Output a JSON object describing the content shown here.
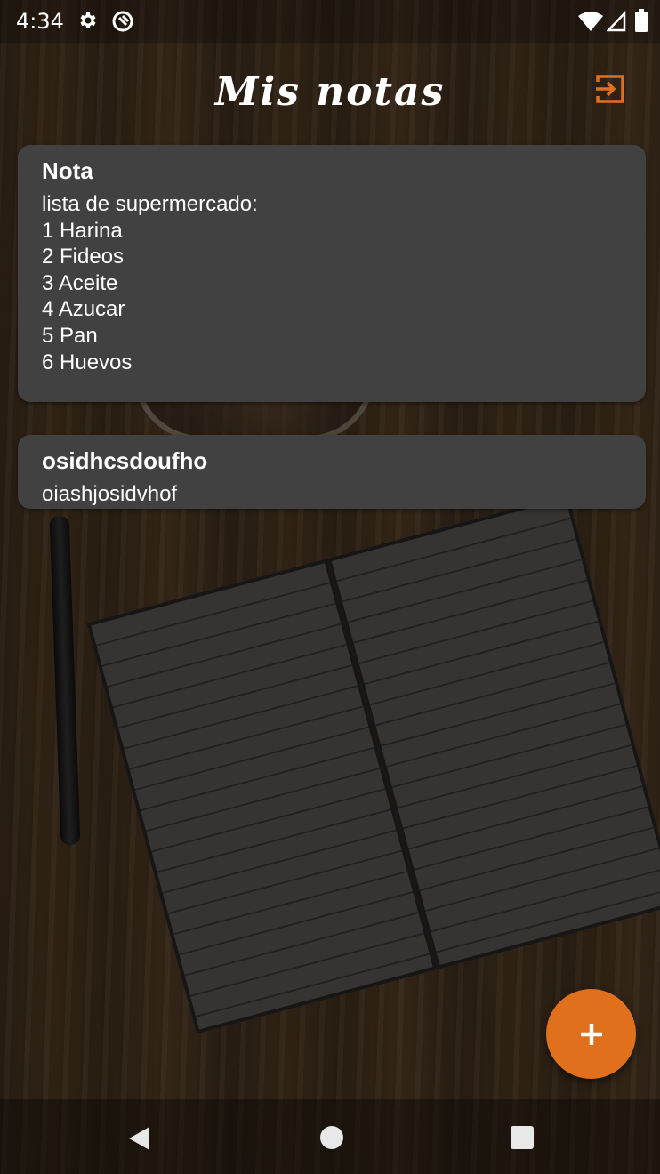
{
  "status_bar": {
    "time": "4:34",
    "icons": [
      "gear-icon",
      "sync-icon",
      "wifi-icon",
      "signal-icon",
      "battery-icon"
    ]
  },
  "header": {
    "title": "Mis notas",
    "logout_icon": "logout-icon"
  },
  "notes": [
    {
      "title": "Nota",
      "body": "lista de supermercado:\n1 Harina\n2 Fideos\n3 Aceite\n4 Azucar\n5 Pan\n6 Huevos"
    },
    {
      "title": "osidhcsdoufho",
      "body": "oiashjosidvhof"
    }
  ],
  "fab": {
    "icon": "plus-icon"
  },
  "navigation": {
    "icons": [
      "back-icon",
      "home-icon",
      "recents-icon"
    ]
  },
  "colors": {
    "accent": "#e0701b",
    "card_background": "#414141",
    "text": "#ffffff"
  }
}
